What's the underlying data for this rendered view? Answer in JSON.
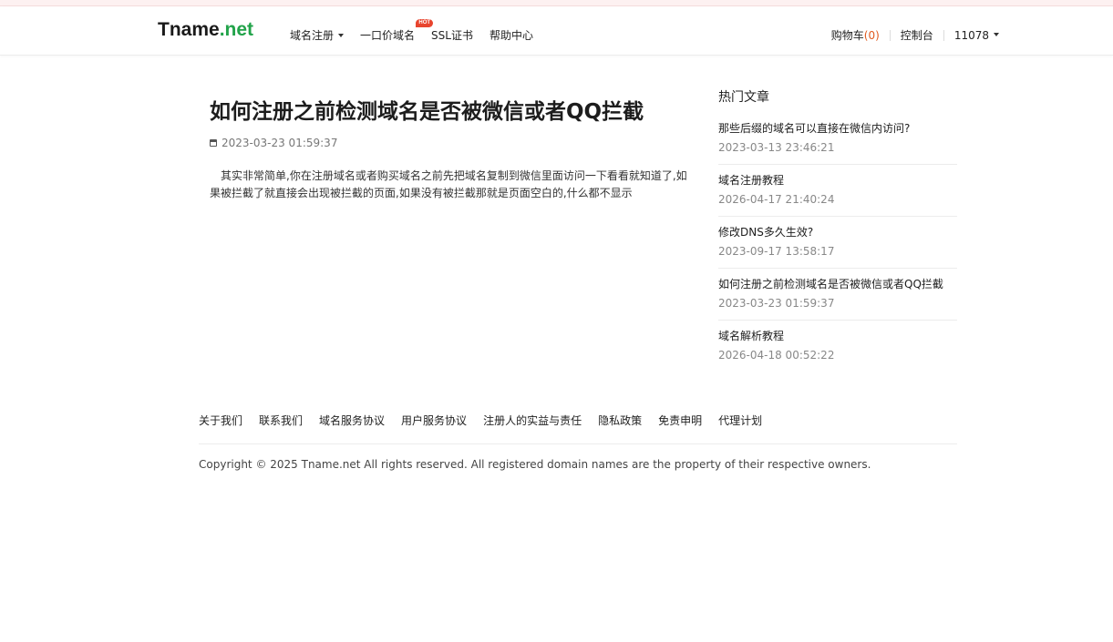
{
  "brand": {
    "name": "Tname",
    "tld": ".net"
  },
  "nav": [
    {
      "label": "域名注册",
      "dropdown": true
    },
    {
      "label": "一口价域名",
      "badge": "HOT"
    },
    {
      "label": "SSL证书"
    },
    {
      "label": "帮助中心"
    }
  ],
  "right_nav": {
    "cart_label": "购物车",
    "cart_count": "(0)",
    "console_label": "控制台",
    "user_label": "11078"
  },
  "article": {
    "title": "如何注册之前检测域名是否被微信或者QQ拦截",
    "date": "2023-03-23 01:59:37",
    "body": "其实非常简单,你在注册域名或者购买域名之前先把域名复制到微信里面访问一下看看就知道了,如果被拦截了就直接会出现被拦截的页面,如果没有被拦截那就是页面空白的,什么都不显示"
  },
  "sidebar": {
    "title": "热门文章",
    "items": [
      {
        "title": "那些后缀的域名可以直接在微信内访问?",
        "date": "2023-03-13 23:46:21"
      },
      {
        "title": "域名注册教程",
        "date": "2026-04-17 21:40:24"
      },
      {
        "title": "修改DNS多久生效?",
        "date": "2023-09-17 13:58:17"
      },
      {
        "title": "如何注册之前检测域名是否被微信或者QQ拦截",
        "date": "2023-03-23 01:59:37"
      },
      {
        "title": "域名解析教程",
        "date": "2026-04-18 00:52:22"
      }
    ]
  },
  "footer": {
    "links": [
      "关于我们",
      "联系我们",
      "域名服务协议",
      "用户服务协议",
      "注册人的实益与责任",
      "隐私政策",
      "免责申明",
      "代理计划"
    ],
    "copyright": "Copyright © 2025 Tname.net All rights reserved. All registered domain names are the property of their respective owners."
  },
  "colors": {
    "brand_green": "#22a34a",
    "hot_badge": "#e8442e",
    "cart_count": "#e05a20"
  }
}
